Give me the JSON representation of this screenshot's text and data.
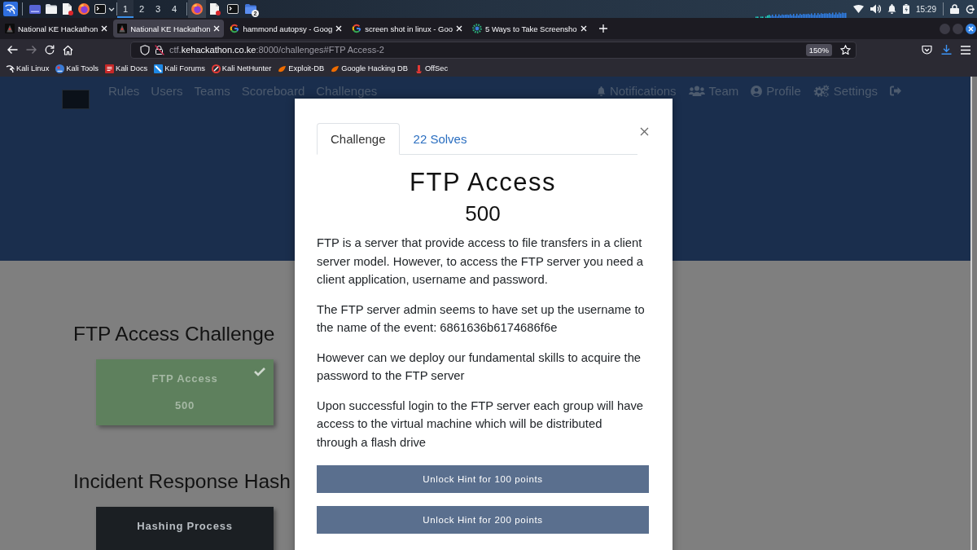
{
  "taskbar": {
    "workspaces": [
      {
        "label": "1",
        "selected": true
      },
      {
        "label": "2",
        "selected": false
      },
      {
        "label": "3",
        "selected": false
      },
      {
        "label": "4",
        "selected": false
      }
    ],
    "tasks": [
      {
        "active": true
      },
      {
        "active": false
      },
      {
        "active": false
      },
      {
        "active": false,
        "badge": "2"
      }
    ],
    "clock": "15:29"
  },
  "browser": {
    "tabs": [
      {
        "title": "National KE Hackathon",
        "selected": false
      },
      {
        "title": "National KE Hackathon",
        "selected": true
      },
      {
        "title": "hammond autopsy - Goog",
        "selected": false
      },
      {
        "title": "screen shot in linux - Goo",
        "selected": false
      },
      {
        "title": "5 Ways to Take Screensho",
        "selected": false
      }
    ],
    "navigation": {
      "back_disabled": false,
      "forward_disabled": true
    },
    "address": {
      "prefix": "ctf.",
      "domain": "kehackathon.co.ke",
      "suffix": ":8000/challenges#FTP Access-2",
      "zoom": "150%"
    },
    "bookmarks": [
      "Kali Linux",
      "Kali Tools",
      "Kali Docs",
      "Kali Forums",
      "Kali NetHunter",
      "Exploit-DB",
      "Google Hacking DB",
      "OffSec"
    ]
  },
  "site": {
    "nav_links": [
      "Rules",
      "Users",
      "Teams",
      "Scoreboard",
      "Challenges"
    ],
    "user_links": [
      "Notifications",
      "Team",
      "Profile",
      "Settings"
    ],
    "categories": [
      {
        "title": "FTP Access Challenge",
        "challenges": [
          {
            "name": "FTP Access",
            "value": "500",
            "solved": true
          }
        ]
      },
      {
        "title": "Incident Response Hash",
        "challenges": [
          {
            "name": "Hashing Process",
            "solved": false
          }
        ]
      }
    ]
  },
  "modal": {
    "tabs": [
      {
        "label": "Challenge",
        "selected": true
      },
      {
        "label": "22 Solves",
        "selected": false
      }
    ],
    "title": "FTP Access",
    "value": "500",
    "description": [
      "FTP is a server that provide access to file transfers in a client server model. However, to access the FTP server you need a client application, username and password.",
      "The FTP server admin seems to have set up the username to the name of the event: 6861636b6174686f6e",
      "However can we deploy our fundamental skills to acquire the password to the FTP server",
      "Upon successful login to the FTP server each group will have access to the virtual machine which will be distributed through a flash drive"
    ],
    "hints": [
      "Unlock Hint for 100 points",
      "Unlock Hint for 200 points"
    ]
  }
}
